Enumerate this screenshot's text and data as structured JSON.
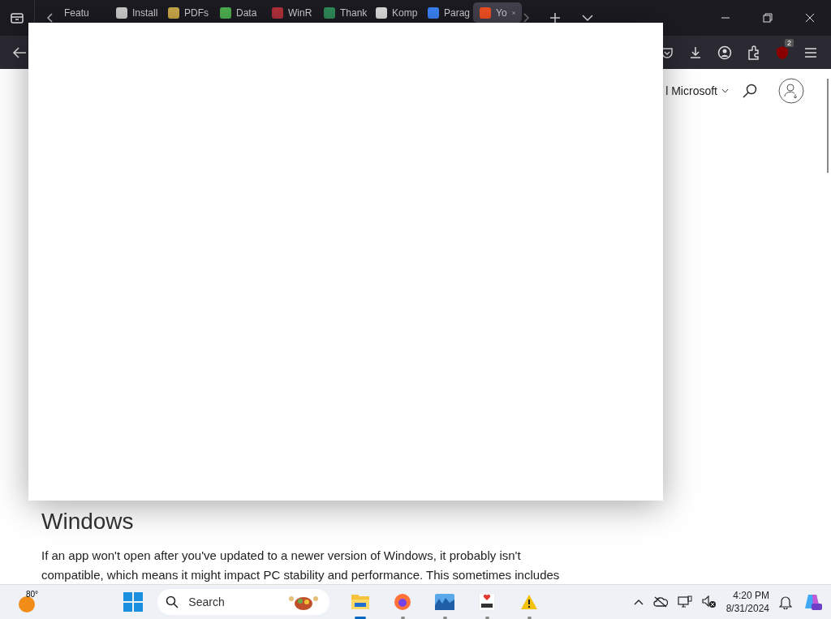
{
  "tabs": [
    {
      "label": "Featu",
      "selected": false
    },
    {
      "label": "Install",
      "selected": false
    },
    {
      "label": "PDFs",
      "selected": false
    },
    {
      "label": "Data",
      "selected": false
    },
    {
      "label": "WinR",
      "selected": false
    },
    {
      "label": "Thank",
      "selected": false
    },
    {
      "label": "Komp",
      "selected": false
    },
    {
      "label": "Parag",
      "selected": false
    },
    {
      "label": "Yo",
      "selected": true
    }
  ],
  "toolbar": {
    "extension_badge": "2"
  },
  "page": {
    "nav_label": "l Microsoft",
    "heading": "Windows",
    "paragraph_lines": [
      "If an app won't open after you've updated to a newer version of Windows, it probably isn't",
      "compatible, which means it might impact PC stability and performance. This sometimes includes"
    ]
  },
  "taskbar": {
    "weather": "80°",
    "search_placeholder": "Search",
    "apps": [
      {
        "selected": true
      },
      {
        "selected": false
      },
      {
        "selected": false
      },
      {
        "selected": false
      },
      {
        "selected": false
      }
    ],
    "time": "4:20 PM",
    "date": "8/31/2024"
  }
}
